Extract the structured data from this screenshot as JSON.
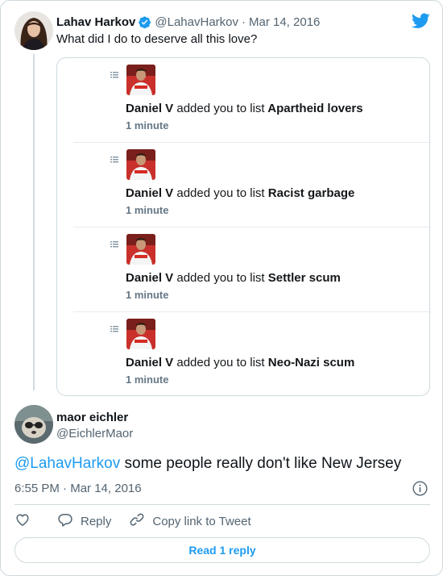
{
  "parent_tweet": {
    "name": "Lahav Harkov",
    "handle": "@LahavHarkov",
    "separator": "·",
    "date": "Mar 14, 2016",
    "text": "What did I do to deserve all this love?"
  },
  "embedded_notifications": [
    {
      "actor": "Daniel V",
      "action": "added you to list",
      "list_name": "Apartheid lovers",
      "time": "1 minute"
    },
    {
      "actor": "Daniel V",
      "action": "added you to list",
      "list_name": "Racist garbage",
      "time": "1 minute"
    },
    {
      "actor": "Daniel V",
      "action": "added you to list",
      "list_name": "Settler scum",
      "time": "1 minute"
    },
    {
      "actor": "Daniel V",
      "action": "added you to list",
      "list_name": "Neo-Nazi scum",
      "time": "1 minute"
    }
  ],
  "reply_tweet": {
    "name": "maor eichler",
    "handle": "@EichlerMaor",
    "mention": "@LahavHarkov",
    "text": " some people really don't like New Jersey",
    "time": "6:55 PM",
    "separator": "·",
    "date": "Mar 14, 2016"
  },
  "actions": {
    "reply_label": "Reply",
    "copy_link_label": "Copy link to Tweet"
  },
  "read_replies_label": "Read 1 reply",
  "colors": {
    "accent": "#1d9bf0",
    "text_primary": "#0f1419",
    "text_secondary": "#536471",
    "border": "#cfd9de"
  },
  "icons": [
    "verified-badge-icon",
    "twitter-bird-icon",
    "list-icon",
    "info-icon",
    "heart-icon",
    "reply-bubble-icon",
    "link-icon"
  ]
}
